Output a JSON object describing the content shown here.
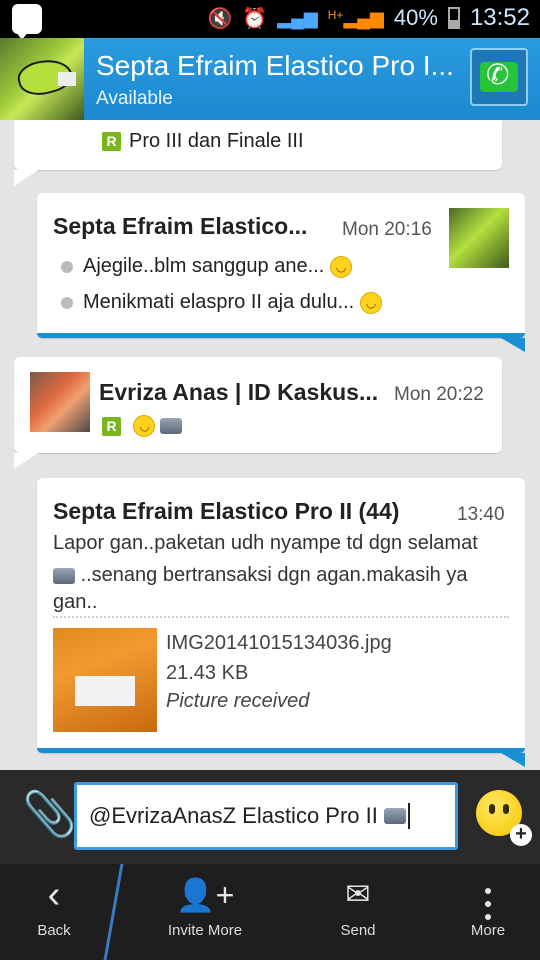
{
  "status_bar": {
    "battery_pct": "40%",
    "time": "13:52",
    "network": "H+"
  },
  "header": {
    "title": "Septa Efraim Elastico Pro I...",
    "status": "Available",
    "accent_color": "#1c88cf"
  },
  "messages": [
    {
      "direction": "in",
      "partial": true,
      "text": "Pro III dan Finale III"
    },
    {
      "direction": "out",
      "sender": "Septa Efraim Elastico...",
      "time": "Mon 20:16",
      "lines": [
        "Ajegile..blm sanggup ane...",
        "Menikmati elaspro II aja dulu..."
      ]
    },
    {
      "direction": "in",
      "sender": "Evriza Anas | ID Kaskus...",
      "time": "Mon 20:22"
    },
    {
      "direction": "out",
      "sender": "Septa Efraim Elastico Pro II (44)",
      "time": "13:40",
      "text_line1": "Lapor gan..paketan udh nyampe td dgn selamat",
      "text_line2": "..senang bertransaksi dgn agan.makasih ya",
      "text_line3": "gan..",
      "file_name": "IMG20141015134036.jpg",
      "file_size": "21.43 KB",
      "file_status": "Picture received"
    }
  ],
  "composer": {
    "input_value": "@EvrizaAnasZ Elastico Pro II"
  },
  "bottom_bar": {
    "back_label": "Back",
    "invite_label": "Invite More",
    "send_label": "Send",
    "more_label": "More"
  }
}
